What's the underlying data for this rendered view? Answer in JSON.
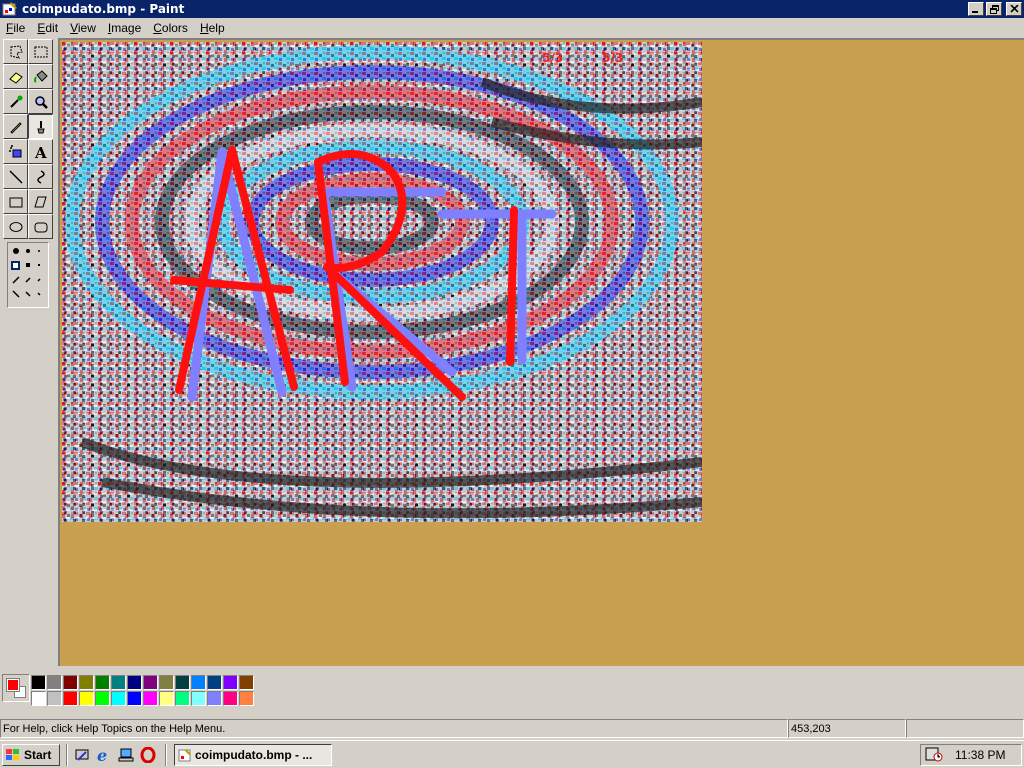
{
  "window": {
    "title": "coimpudato.bmp - Paint"
  },
  "menu": {
    "items": [
      {
        "label": "File",
        "accel": "F",
        "rest": "ile"
      },
      {
        "label": "Edit",
        "accel": "E",
        "rest": "dit"
      },
      {
        "label": "View",
        "accel": "V",
        "rest": "iew"
      },
      {
        "label": "Image",
        "accel": "I",
        "rest": "mage"
      },
      {
        "label": "Colors",
        "accel": "C",
        "rest": "olors"
      },
      {
        "label": "Help",
        "accel": "H",
        "rest": "elp"
      }
    ]
  },
  "tools": [
    "free-form-select",
    "select",
    "eraser",
    "fill-with-color",
    "pick-color",
    "magnifier",
    "pencil",
    "brush",
    "airbrush",
    "text",
    "line",
    "curve",
    "rectangle",
    "polygon",
    "ellipse",
    "rounded-rectangle"
  ],
  "active_tool": "brush",
  "canvas": {
    "art_text": "ART",
    "stroke_primary": "#ff1010",
    "stroke_secondary": "#8080ff"
  },
  "colors": {
    "foreground": "#ff0000",
    "background": "#ffffff",
    "workspace": "#c9a04f"
  },
  "palette": {
    "row1": [
      "#000000",
      "#808080",
      "#800000",
      "#808000",
      "#008000",
      "#008080",
      "#000080",
      "#800080",
      "#808040",
      "#004040",
      "#0080ff",
      "#004080",
      "#8000ff",
      "#804000"
    ],
    "row2": [
      "#ffffff",
      "#c0c0c0",
      "#ff0000",
      "#ffff00",
      "#00ff00",
      "#00ffff",
      "#0000ff",
      "#ff00ff",
      "#ffff80",
      "#00ff80",
      "#80ffff",
      "#8080ff",
      "#ff0080",
      "#ff8040"
    ]
  },
  "status": {
    "help": "For Help, click Help Topics on the Help Menu.",
    "coords": "453,203",
    "size": ""
  },
  "taskbar": {
    "start": "Start",
    "task": "coimpudato.bmp - ...",
    "clock": "11:38 PM"
  }
}
